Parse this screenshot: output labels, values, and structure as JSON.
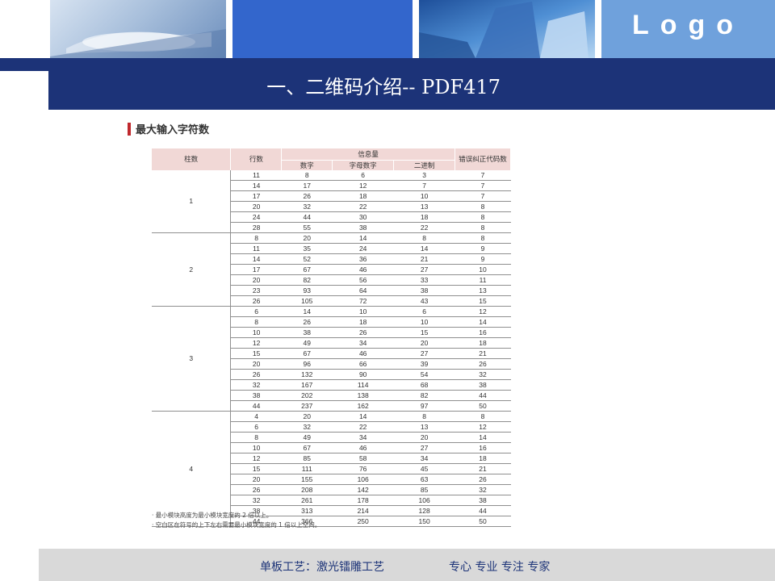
{
  "header": {
    "logo_text": "Logo",
    "title": "一、二维码介绍-- PDF417"
  },
  "section": {
    "title": "最大输入字符数"
  },
  "table": {
    "headers": {
      "columns": "柱数",
      "rows": "行数",
      "info": "信息量",
      "numeric": "数字",
      "alphanumeric": "字母数字",
      "binary": "二进制",
      "ecc": "错误纠正代码数"
    },
    "groups": [
      {
        "columns": "1",
        "rows": [
          [
            "11",
            "8",
            "6",
            "3",
            "7"
          ],
          [
            "14",
            "17",
            "12",
            "7",
            "7"
          ],
          [
            "17",
            "26",
            "18",
            "10",
            "7"
          ],
          [
            "20",
            "32",
            "22",
            "13",
            "8"
          ],
          [
            "24",
            "44",
            "30",
            "18",
            "8"
          ],
          [
            "28",
            "55",
            "38",
            "22",
            "8"
          ]
        ]
      },
      {
        "columns": "2",
        "rows": [
          [
            "8",
            "20",
            "14",
            "8",
            "8"
          ],
          [
            "11",
            "35",
            "24",
            "14",
            "9"
          ],
          [
            "14",
            "52",
            "36",
            "21",
            "9"
          ],
          [
            "17",
            "67",
            "46",
            "27",
            "10"
          ],
          [
            "20",
            "82",
            "56",
            "33",
            "11"
          ],
          [
            "23",
            "93",
            "64",
            "38",
            "13"
          ],
          [
            "26",
            "105",
            "72",
            "43",
            "15"
          ]
        ]
      },
      {
        "columns": "3",
        "rows": [
          [
            "6",
            "14",
            "10",
            "6",
            "12"
          ],
          [
            "8",
            "26",
            "18",
            "10",
            "14"
          ],
          [
            "10",
            "38",
            "26",
            "15",
            "16"
          ],
          [
            "12",
            "49",
            "34",
            "20",
            "18"
          ],
          [
            "15",
            "67",
            "46",
            "27",
            "21"
          ],
          [
            "20",
            "96",
            "66",
            "39",
            "26"
          ],
          [
            "26",
            "132",
            "90",
            "54",
            "32"
          ],
          [
            "32",
            "167",
            "114",
            "68",
            "38"
          ],
          [
            "38",
            "202",
            "138",
            "82",
            "44"
          ],
          [
            "44",
            "237",
            "162",
            "97",
            "50"
          ]
        ]
      },
      {
        "columns": "4",
        "rows": [
          [
            "4",
            "20",
            "14",
            "8",
            "8"
          ],
          [
            "6",
            "32",
            "22",
            "13",
            "12"
          ],
          [
            "8",
            "49",
            "34",
            "20",
            "14"
          ],
          [
            "10",
            "67",
            "46",
            "27",
            "16"
          ],
          [
            "12",
            "85",
            "58",
            "34",
            "18"
          ],
          [
            "15",
            "111",
            "76",
            "45",
            "21"
          ],
          [
            "20",
            "155",
            "106",
            "63",
            "26"
          ],
          [
            "26",
            "208",
            "142",
            "85",
            "32"
          ],
          [
            "32",
            "261",
            "178",
            "106",
            "38"
          ],
          [
            "38",
            "313",
            "214",
            "128",
            "44"
          ],
          [
            "44",
            "366",
            "250",
            "150",
            "50"
          ]
        ]
      }
    ]
  },
  "notes": [
    "· 最小模块高度为最小模块宽度的 2 倍以上。",
    "· 空白区在符号的上下左右需要最小模块宽度的 1 倍以上空间。"
  ],
  "footer": {
    "left": "单板工艺：激光镭雕工艺",
    "right": "专心 专业 专注 专家"
  }
}
